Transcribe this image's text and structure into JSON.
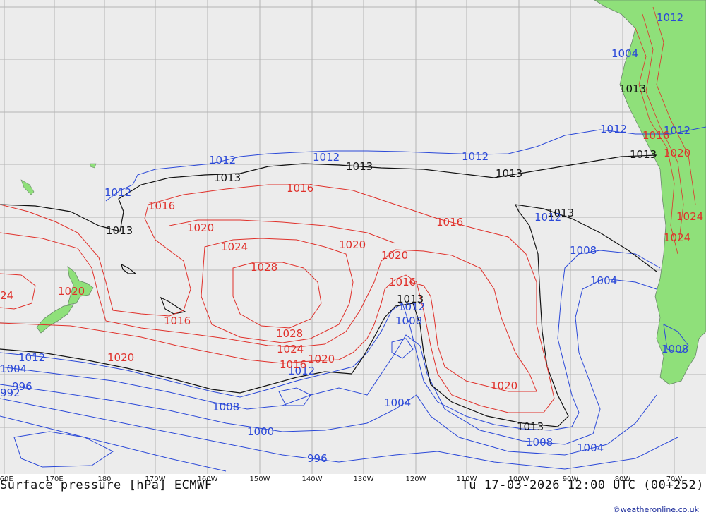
{
  "map": {
    "title_left": "Surface pressure [hPa] ECMWF",
    "title_right": "Tu 17-03-2026 12:00 UTC (00+252)",
    "credit": "©weatheronline.co.uk",
    "colors": {
      "ocean": "#ececec",
      "land": "#8fe07a",
      "grid": "#b4b4b4",
      "low_pressure": "#2a48d8",
      "high_pressure": "#e0302a",
      "reference_1013": "#111111"
    },
    "longitude_labels": [
      "160E",
      "170E",
      "180",
      "170W",
      "160W",
      "150W",
      "140W",
      "130W",
      "120W",
      "110W",
      "100W",
      "90W",
      "80W",
      "70W"
    ],
    "isobar_labels": {
      "black": [
        "1013",
        "1013",
        "1013",
        "1013",
        "1013",
        "1013",
        "1013",
        "1013",
        "1013"
      ],
      "blue": [
        "1012",
        "1012",
        "1012",
        "1012",
        "1012",
        "1012",
        "1012",
        "1012",
        "1012",
        "1012",
        "1012",
        "1008",
        "1008",
        "1008",
        "1008",
        "1008",
        "1004",
        "1004",
        "1004",
        "1004",
        "1004",
        "1000",
        "996",
        "996",
        "992"
      ],
      "red": [
        "1016",
        "1016",
        "1016",
        "1016",
        "1016",
        "1016",
        "1016",
        "1020",
        "1020",
        "1020",
        "1020",
        "1020",
        "1020",
        "1020",
        "1020",
        "1024",
        "1024",
        "1024",
        "1024",
        "1028",
        "1028",
        "24"
      ]
    }
  }
}
